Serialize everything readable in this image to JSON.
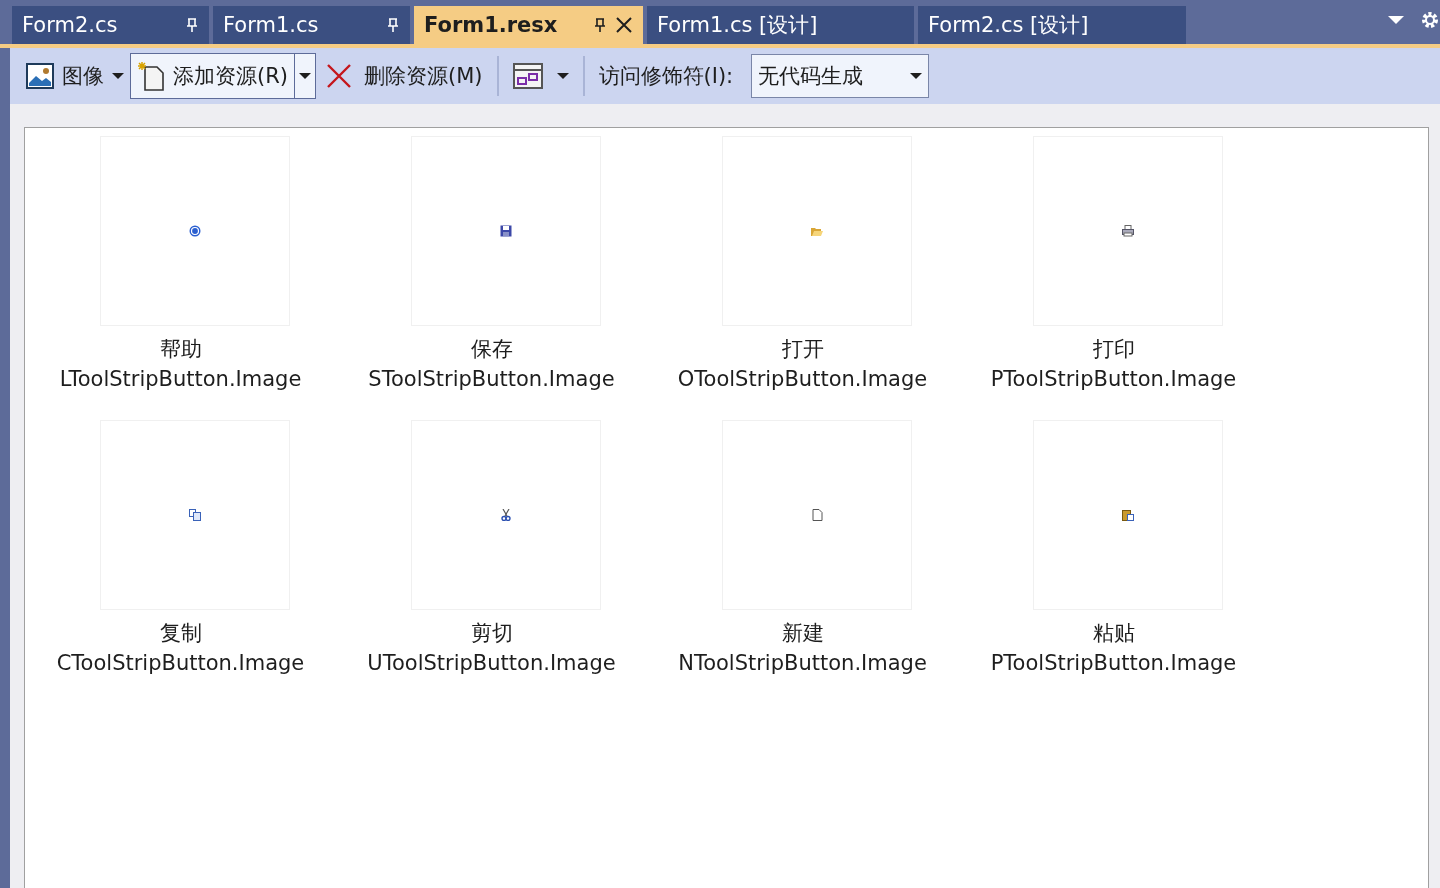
{
  "tabs": [
    {
      "label": "Form2.cs",
      "selected": false,
      "pinned": true,
      "closable": false
    },
    {
      "label": "Form1.cs",
      "selected": false,
      "pinned": true,
      "closable": false
    },
    {
      "label": "Form1.resx",
      "selected": true,
      "pinned": true,
      "closable": true
    },
    {
      "label": "Form1.cs [设计]",
      "selected": false,
      "pinned": false,
      "closable": false
    },
    {
      "label": "Form2.cs [设计]",
      "selected": false,
      "pinned": false,
      "closable": false
    }
  ],
  "toolbar": {
    "resource_type": "图像",
    "add_resource": "添加资源(R)",
    "remove_resource": "删除资源(M)",
    "access_modifier_label": "访问修饰符(I):",
    "access_modifier": "无代码生成"
  },
  "resources": [
    {
      "name": "帮助",
      "caption": "LToolStripButton.Image",
      "kind": "help"
    },
    {
      "name": "保存",
      "caption": "SToolStripButton.Image",
      "kind": "save"
    },
    {
      "name": "打开",
      "caption": "OToolStripButton.Image",
      "kind": "open"
    },
    {
      "name": "打印",
      "caption": "PToolStripButton.Image",
      "kind": "print"
    },
    {
      "name": "复制",
      "caption": "CToolStripButton.Image",
      "kind": "copy"
    },
    {
      "name": "剪切",
      "caption": "UToolStripButton.Image",
      "kind": "cut"
    },
    {
      "name": "新建",
      "caption": "NToolStripButton.Image",
      "kind": "new"
    },
    {
      "name": "粘贴",
      "caption": "PToolStripButton.Image",
      "kind": "paste"
    }
  ]
}
